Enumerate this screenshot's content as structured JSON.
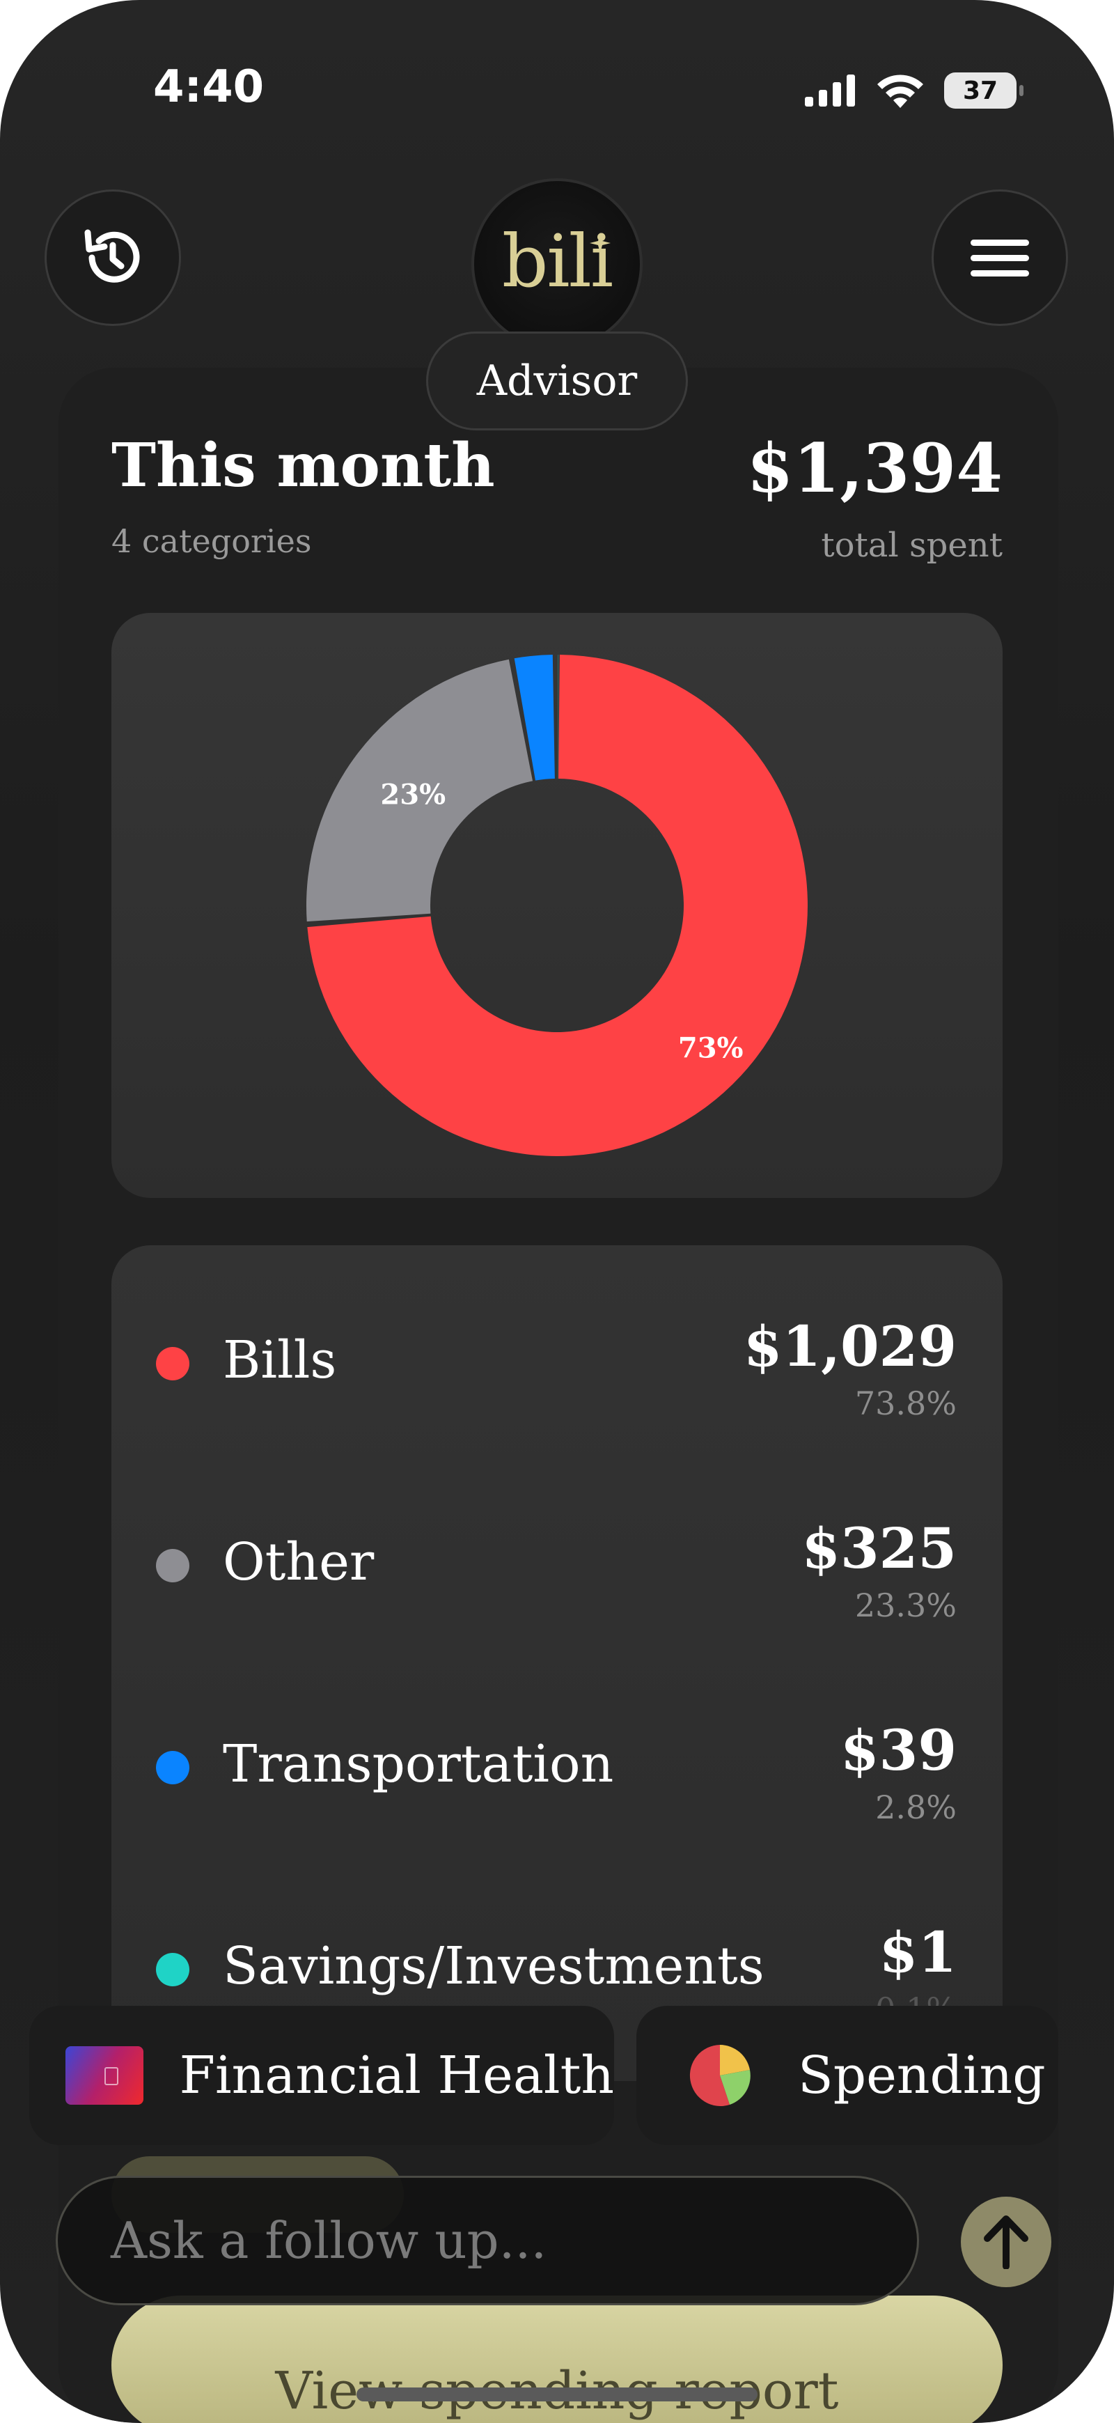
{
  "status_bar": {
    "time": "4:40",
    "battery": "37"
  },
  "header": {
    "logo": "bili",
    "subtitle": "Advisor",
    "left_icon": "history-icon",
    "right_icon": "menu-icon"
  },
  "summary": {
    "title": "This month",
    "categories_text": "4 categories",
    "total": "$1,394",
    "total_label": "total spent"
  },
  "chart_data": {
    "type": "pie",
    "style": "donut",
    "categories": [
      "Bills",
      "Other",
      "Transportation",
      "Savings/Investments"
    ],
    "values": [
      73.8,
      23.3,
      2.8,
      0.1
    ],
    "slice_labels": [
      "73%",
      "23%",
      "",
      ""
    ],
    "colors": [
      "#fe4245",
      "#8e8e93",
      "#0a84ff",
      "#1fd3c6"
    ]
  },
  "categories": [
    {
      "name": "Bills",
      "amount": "$1,029",
      "percent": "73.8%",
      "color": "#fe4245"
    },
    {
      "name": "Other",
      "amount": "$325",
      "percent": "23.3%",
      "color": "#8e8e93"
    },
    {
      "name": "Transportation",
      "amount": "$39",
      "percent": "2.8%",
      "color": "#0a84ff"
    },
    {
      "name": "Savings/Investments",
      "amount": "$1",
      "percent": "0.1%",
      "color": "#1fd3c6"
    }
  ],
  "chips": [
    {
      "label": "Financial Health",
      "icon": "credit-card-icon"
    },
    {
      "label": "Spending",
      "icon": "pie-chart-icon"
    }
  ],
  "input": {
    "placeholder": "Ask a follow up..."
  },
  "footer": {
    "report_button": "View spending report"
  }
}
